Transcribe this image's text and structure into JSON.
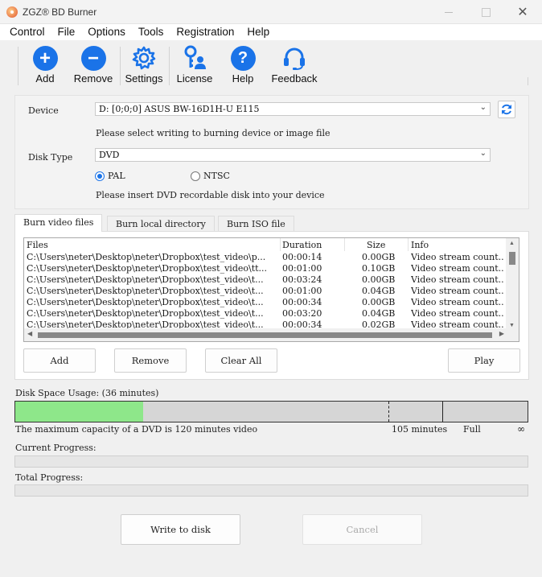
{
  "window": {
    "title": "ZGZ® BD Burner",
    "close_glyph": "✕"
  },
  "menu": [
    "Control",
    "File",
    "Options",
    "Tools",
    "Registration",
    "Help"
  ],
  "toolbar": [
    {
      "label": "Add",
      "icon": "add-icon"
    },
    {
      "label": "Remove",
      "icon": "remove-icon"
    },
    {
      "label": "Settings",
      "icon": "gear-icon"
    },
    {
      "label": "License",
      "icon": "license-icon"
    },
    {
      "label": "Help",
      "icon": "help-icon"
    },
    {
      "label": "Feedback",
      "icon": "headset-icon"
    }
  ],
  "device": {
    "label": "Device",
    "value": "D:  [0;0;0] ASUS BW-16D1H-U E115",
    "hint": "Please select writing to burning device or image file"
  },
  "disk": {
    "label": "Disk Type",
    "value": "DVD",
    "pal": "PAL",
    "ntsc": "NTSC",
    "selected": "PAL",
    "hint": "Please insert DVD recordable disk into your device"
  },
  "tabs": [
    "Burn video files",
    "Burn local directory",
    "Burn ISO file"
  ],
  "list": {
    "headers": [
      "Files",
      "Duration",
      "Size",
      "Info"
    ],
    "rows": [
      [
        "C:\\Users\\neter\\Desktop\\neter\\Dropbox\\test_video\\p...",
        "00:00:14",
        "0.00GB",
        "Video stream count.."
      ],
      [
        "C:\\Users\\neter\\Desktop\\neter\\Dropbox\\test_video\\tt...",
        "00:01:00",
        "0.10GB",
        "Video stream count.."
      ],
      [
        "C:\\Users\\neter\\Desktop\\neter\\Dropbox\\test_video\\t...",
        "00:03:24",
        "0.00GB",
        "Video stream count.."
      ],
      [
        "C:\\Users\\neter\\Desktop\\neter\\Dropbox\\test_video\\t...",
        "00:01:00",
        "0.04GB",
        "Video stream count.."
      ],
      [
        "C:\\Users\\neter\\Desktop\\neter\\Dropbox\\test_video\\t...",
        "00:00:34",
        "0.00GB",
        "Video stream count.."
      ],
      [
        "C:\\Users\\neter\\Desktop\\neter\\Dropbox\\test_video\\t...",
        "00:03:20",
        "0.04GB",
        "Video stream count.."
      ],
      [
        "C:\\Users\\neter\\Desktop\\neter\\Dropbox\\test_video\\t...",
        "00:00:34",
        "0.02GB",
        "Video stream count.."
      ]
    ]
  },
  "list_buttons": {
    "add": "Add",
    "remove": "Remove",
    "clear": "Clear All",
    "play": "Play"
  },
  "usage": {
    "label": "Disk Space Usage: (36 minutes)",
    "used_minutes": 36,
    "mark_105_minutes": 105,
    "full_minutes": 120,
    "scale_minutes": 144,
    "capacity_note": "The maximum capacity of a DVD is 120 minutes video",
    "mark_105": "105 minutes",
    "full": "Full",
    "infinity": "∞",
    "fill_color": "#8ee78a"
  },
  "progress": {
    "current_label": "Current Progress:",
    "current_value": 0,
    "total_label": "Total Progress:",
    "total_value": 0
  },
  "actions": {
    "write": "Write to disk",
    "cancel": "Cancel"
  },
  "colors": {
    "accent": "#1a73e8"
  }
}
